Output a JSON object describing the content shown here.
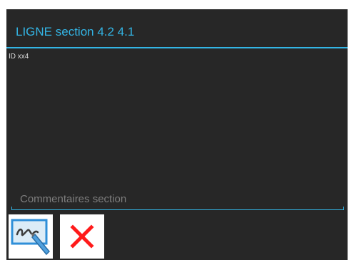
{
  "dialog": {
    "title": "LIGNE section 4.2 4.1",
    "id_label": "ID xx4",
    "comment_field": {
      "placeholder": "Commentaires section",
      "value": ""
    },
    "buttons": {
      "sign_icon": "signature-pen-icon",
      "cancel_icon": "close-icon"
    }
  },
  "colors": {
    "dialog_background": "#272727",
    "accent": "#33b5e5",
    "cancel_red": "#ff1a1a"
  }
}
